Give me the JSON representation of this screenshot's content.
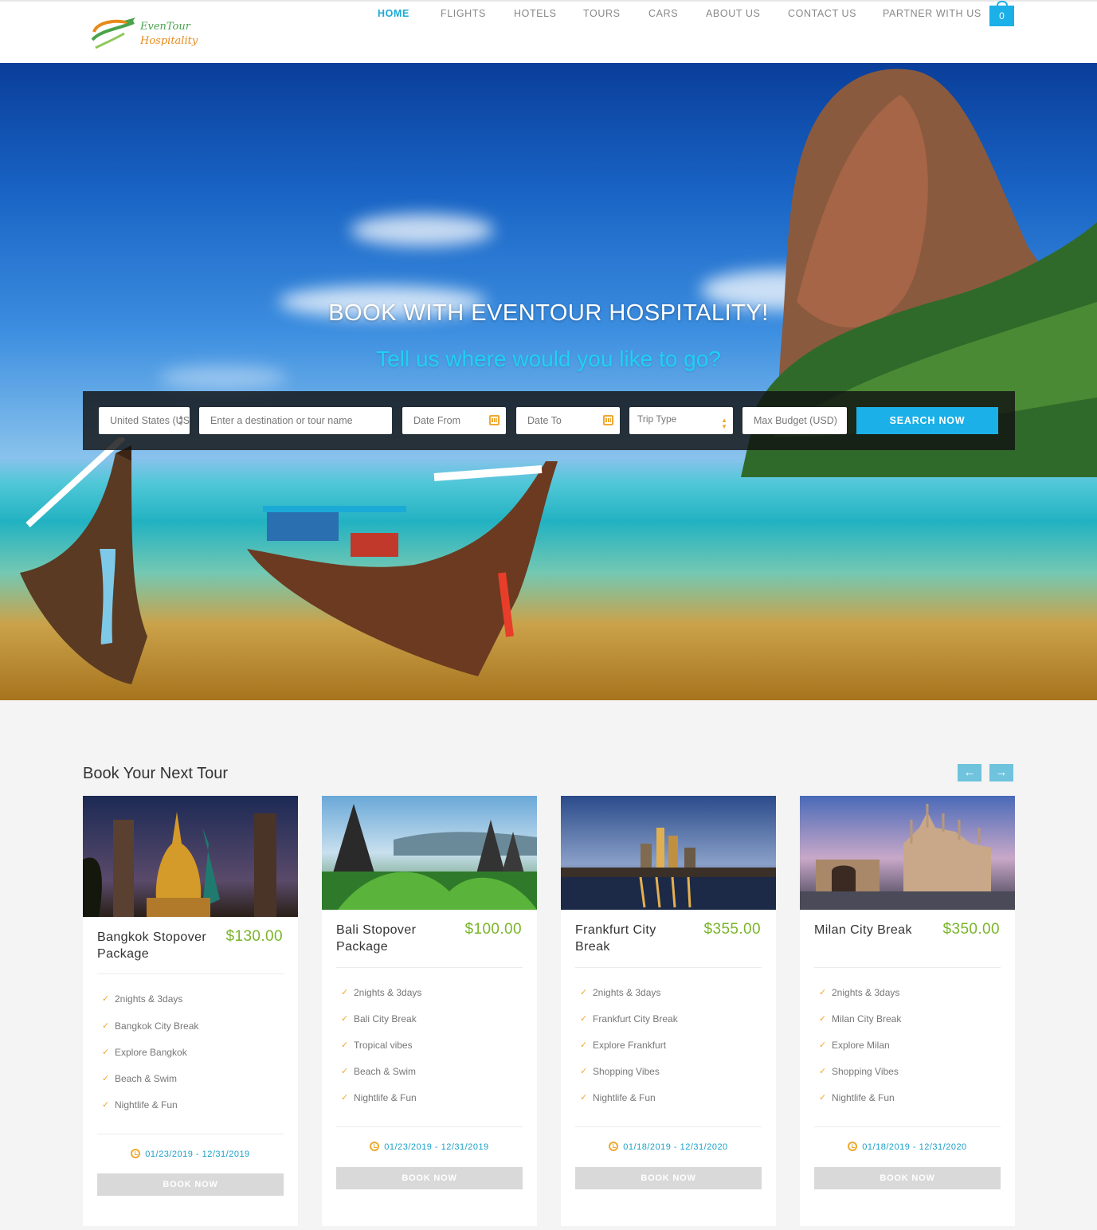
{
  "brand": {
    "line1": "EvenTour",
    "line2": "Hospitality"
  },
  "nav": {
    "items": [
      "HOME",
      "FLIGHTS",
      "HOTELS",
      "TOURS",
      "CARS",
      "ABOUT US",
      "CONTACT US",
      "PARTNER WITH US"
    ],
    "active": "HOME",
    "cart_count": "0"
  },
  "hero": {
    "title": "BOOK WITH EVENTOUR HOSPITALITY!",
    "subtitle": "Tell us where would you like to go?"
  },
  "search": {
    "country": "United States (US",
    "destination_placeholder": "Enter a destination or tour name",
    "date_from_placeholder": "Date From",
    "date_to_placeholder": "Date To",
    "trip_type": "Trip Type",
    "budget_placeholder": "Max Budget (USD)",
    "button": "SEARCH NOW"
  },
  "tours": {
    "title": "Book Your Next Tour",
    "prev_icon": "arrow-left-icon",
    "next_icon": "arrow-right-icon",
    "cards": [
      {
        "name_line1": "Bangkok Stopover",
        "name_line2": "Package",
        "price": "$130.00",
        "features": [
          "2nights & 3days",
          "Bangkok City Break",
          "Explore Bangkok",
          "Beach & Swim",
          "Nightlife & Fun"
        ],
        "dates": "01/23/2019 - 12/31/2019",
        "button": "BOOK NOW"
      },
      {
        "name_line1": "Bali Stopover",
        "name_line2": "Package",
        "price": "$100.00",
        "features": [
          "2nights & 3days",
          "Bali City Break",
          "Tropical vibes",
          "Beach & Swim",
          "Nightlife & Fun"
        ],
        "dates": "01/23/2019 - 12/31/2019",
        "button": "BOOK NOW"
      },
      {
        "name_line1": "Frankfurt City",
        "name_line2": "Break",
        "price": "$355.00",
        "features": [
          "2nights & 3days",
          "Frankfurt City Break",
          "Explore Frankfurt",
          "Shopping Vibes",
          "Nightlife & Fun"
        ],
        "dates": "01/18/2019 - 12/31/2020",
        "button": "BOOK NOW"
      },
      {
        "name_line1": "Milan City Break",
        "name_line2": "",
        "price": "$350.00",
        "features": [
          "2nights & 3days",
          "Milan City Break",
          "Explore Milan",
          "Shopping Vibes",
          "Nightlife & Fun"
        ],
        "dates": "01/18/2019 - 12/31/2020",
        "button": "BOOK NOW"
      }
    ]
  },
  "colors": {
    "accent": "#1bb0e8",
    "price": "#7ab52a",
    "check": "#f0a830",
    "date": "#1ba0c8"
  }
}
